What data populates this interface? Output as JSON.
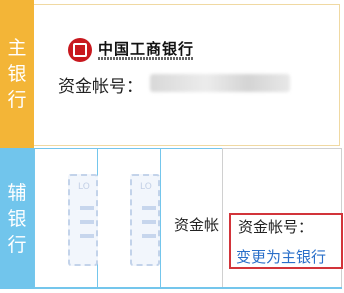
{
  "sidebar": {
    "main_label_chars": [
      "主",
      "银",
      "行"
    ],
    "sub_label_chars": [
      "辅",
      "银",
      "行"
    ]
  },
  "main_bank": {
    "logo_name": "中国工商银行",
    "account_label": "资金帐号："
  },
  "sub_banks": {
    "placeholder_text": "LO",
    "card3_account_label": "资金帐",
    "card4_account_label": "资金帐号：",
    "switch_link_label": "变更为主银行"
  },
  "colors": {
    "main_accent": "#f3b537",
    "sub_accent": "#71c5ec",
    "highlight": "#d2343a",
    "link": "#2a6fc9"
  },
  "icons": [
    "icbc-logo-icon"
  ]
}
